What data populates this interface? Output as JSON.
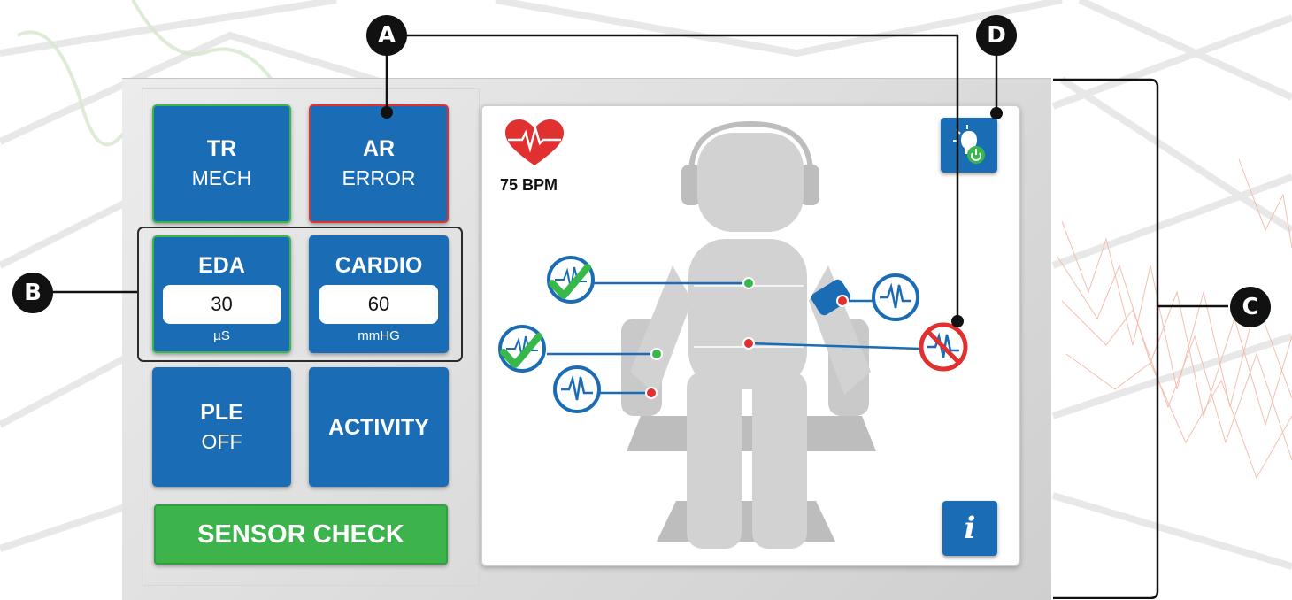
{
  "tiles": {
    "tr": {
      "title": "TR",
      "sub": "MECH"
    },
    "ar": {
      "title": "AR",
      "sub": "ERROR"
    },
    "eda": {
      "title": "EDA",
      "value": "30",
      "unit": "µS"
    },
    "cardio": {
      "title": "CARDIO",
      "value": "60",
      "unit": "mmHG"
    },
    "ple": {
      "title": "PLE",
      "sub": "OFF"
    },
    "activity": {
      "title": "ACTIVITY"
    }
  },
  "sensor_check_label": "SENSOR CHECK",
  "heart_rate": {
    "label": "75 BPM",
    "icon": "heart-pulse-icon"
  },
  "info_button": {
    "label": "i",
    "icon": "info-icon"
  },
  "power_button": {
    "icon": "lightbulb-power-icon"
  },
  "sensor_markers": [
    {
      "name": "chest-sensor",
      "status": "ok",
      "icon": "checkmark-waveform-icon"
    },
    {
      "name": "waist-sensor",
      "status": "error",
      "icon": "no-signal-waveform-icon"
    },
    {
      "name": "left-hand-sensor",
      "status": "ok",
      "icon": "checkmark-waveform-icon"
    },
    {
      "name": "seat-sensor",
      "status": "signal",
      "icon": "waveform-icon"
    },
    {
      "name": "arm-cuff-sensor",
      "status": "signal",
      "icon": "waveform-icon"
    }
  ],
  "callouts": {
    "a": "A",
    "b": "B",
    "c": "C",
    "d": "D"
  },
  "colors": {
    "tile_blue": "#1a6db5",
    "ok_green": "#38b84a",
    "error_red": "#e03030",
    "panel_grey": "#dcdcdc",
    "figure_grey": "#cfcfcf"
  }
}
